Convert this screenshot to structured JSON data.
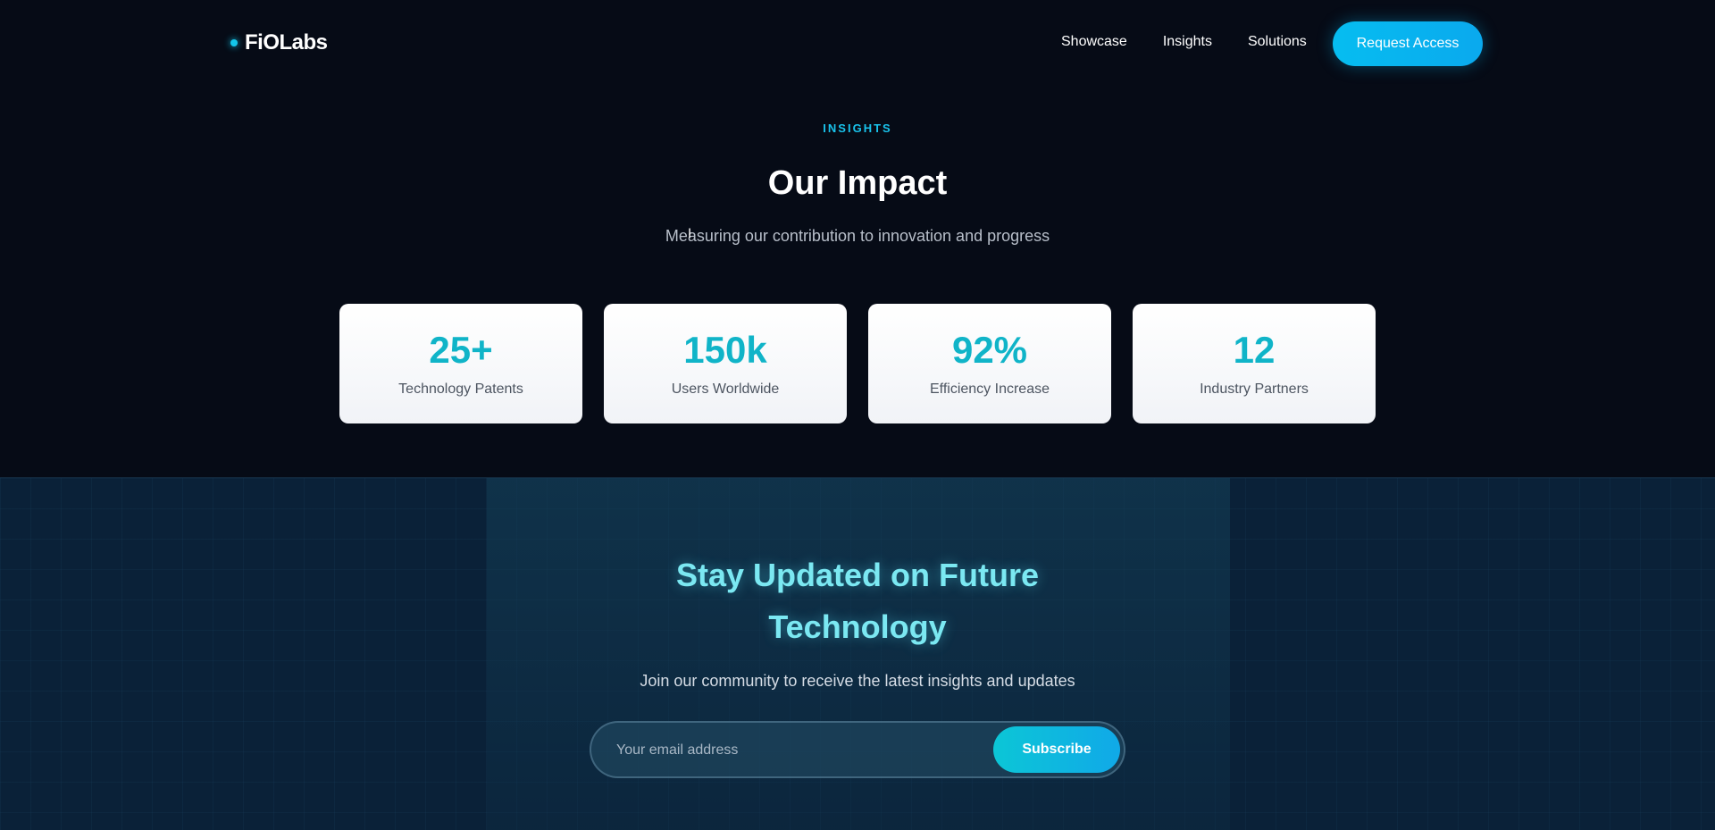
{
  "header": {
    "logo_text": "FiOLabs",
    "nav": [
      "Showcase",
      "Insights",
      "Solutions"
    ],
    "cta_label": "Request Access"
  },
  "insights": {
    "eyebrow": "INSIGHTS",
    "title": "Our Impact",
    "subtitle": "Measuring our contribution to innovation and progress",
    "stats": [
      {
        "value": "25+",
        "label": "Technology Patents"
      },
      {
        "value": "150k",
        "label": "Users Worldwide"
      },
      {
        "value": "92%",
        "label": "Efficiency Increase"
      },
      {
        "value": "12",
        "label": "Industry Partners"
      }
    ]
  },
  "newsletter": {
    "title_line1": "Stay Updated on Future",
    "title_line2": "Technology",
    "subtitle": "Join our community to receive the latest insights and updates",
    "email_placeholder": "Your email address",
    "subscribe_label": "Subscribe"
  },
  "colors": {
    "accent": "#13c6ea",
    "stat_value": "#10b4c8",
    "page_bg": "#060b16",
    "newsletter_bg": "#0a2138"
  }
}
